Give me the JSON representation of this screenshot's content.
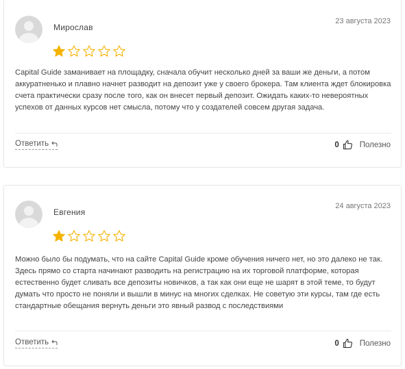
{
  "reviews": [
    {
      "author": "Мирослав",
      "date": "23 августа 2023",
      "rating": 1,
      "max_rating": 5,
      "text": "Capital Guide заманивает на площадку, сначала обучит несколько дней за ваши же деньги, а потом аккуратненько и плавно начнет разводит на депозит уже у своего брокера. Там клиента ждет блокировка счета практически сразу после того, как он внесет первый депозит. Ожидать каких-то невероятных успехов от данных курсов нет смысла, потому что у создателей совсем другая задача.",
      "reply_label": "Ответить",
      "likes": "0",
      "useful_label": "Полезно"
    },
    {
      "author": "Евгения",
      "date": "24 августа 2023",
      "rating": 1,
      "max_rating": 5,
      "text": "Можно было бы подумать, что на сайте Capital Guide кроме обучения ничего нет, но это далеко не так. Здесь прямо со старта начинают разводить на регистрацию на их торговой платформе, которая естественно будет сливать все депозиты новичков, а так как они еще не шарят в этой теме, то будут думать что просто не поняли и вышли в минус на многих сделках. Не советую эти курсы, там где есть стандартные обещания вернуть деньги это явный развод с последствиями",
      "reply_label": "Ответить",
      "likes": "0",
      "useful_label": "Полезно"
    }
  ],
  "colors": {
    "star_filled": "#f5b301",
    "star_outline": "#f5b301",
    "card_border": "#e6e6e6",
    "avatar_bg": "#d9d9d9"
  },
  "icons": {
    "avatar": "user-placeholder-icon",
    "star": "star-icon",
    "reply": "reply-arrow-icon",
    "like": "thumbs-up-icon"
  }
}
